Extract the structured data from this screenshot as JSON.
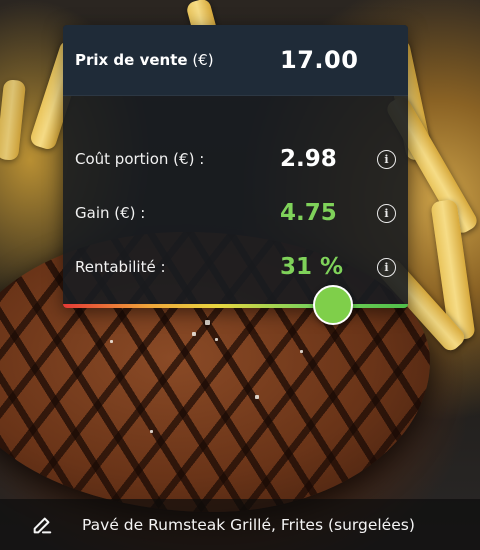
{
  "card": {
    "price": {
      "label": "Prix de vente",
      "unit": "(€)",
      "value": "17.00"
    },
    "rows": [
      {
        "label": "Coût portion (€) :",
        "value": "2.98",
        "color": "#ffffff",
        "icon": "info-icon"
      },
      {
        "label": "Gain (€) :",
        "value": "4.75",
        "color": "#7fd25a",
        "icon": "info-icon"
      },
      {
        "label": "Rentabilité :",
        "value": "31 %",
        "color": "#7fd25a",
        "icon": "info-icon"
      }
    ],
    "profitability_percent": 31,
    "accent_color": "#7fcf4a"
  },
  "caption": {
    "icon": "pencil-edit-icon",
    "text": "Pavé de Rumsteak Grillé, Frites (surgelées)"
  }
}
